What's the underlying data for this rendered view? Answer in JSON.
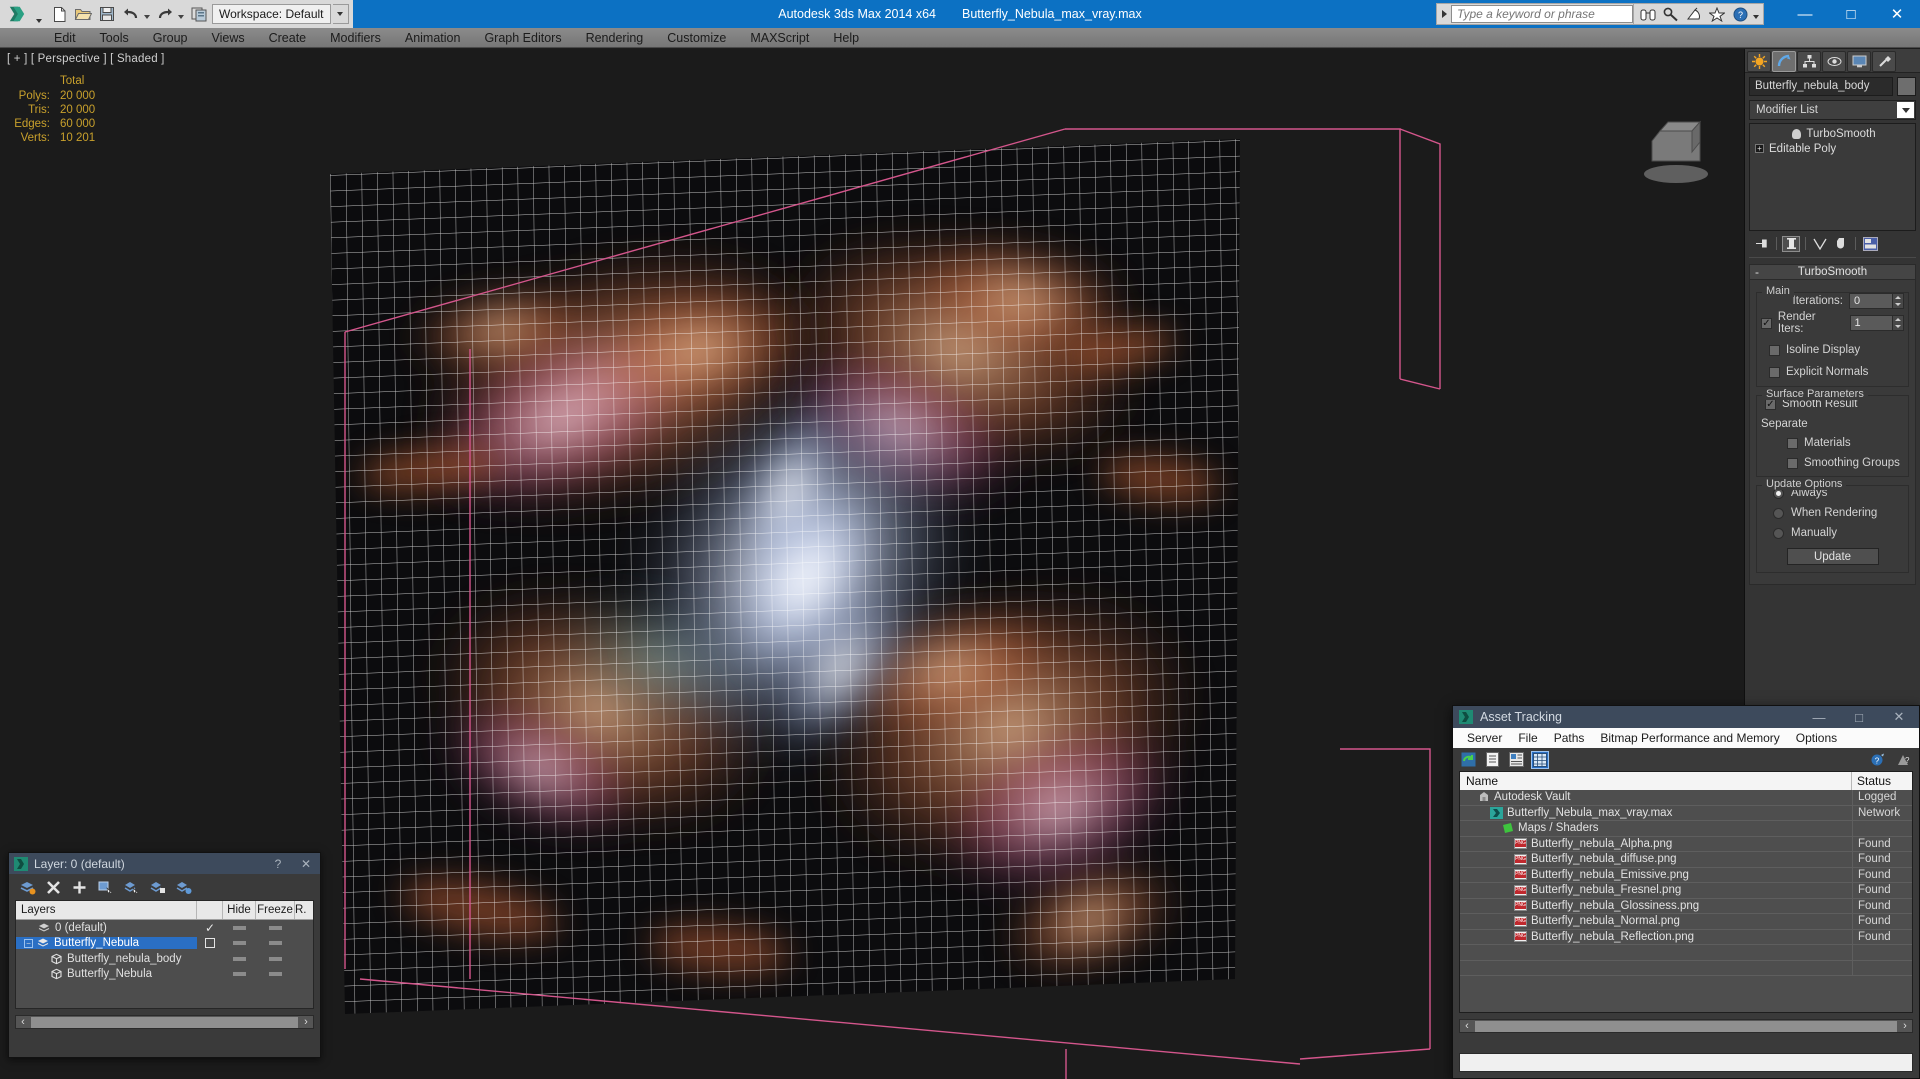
{
  "titlebar": {
    "app_title": "Autodesk 3ds Max  2014 x64",
    "file_name": "Butterfly_Nebula_max_vray.max",
    "workspace_label": "Workspace: Default",
    "search_placeholder": "Type a keyword or phrase",
    "minimize": "—",
    "maximize": "□",
    "close": "✕"
  },
  "menubar": {
    "items": [
      {
        "label": "Edit"
      },
      {
        "label": "Tools"
      },
      {
        "label": "Group"
      },
      {
        "label": "Views"
      },
      {
        "label": "Create"
      },
      {
        "label": "Modifiers"
      },
      {
        "label": "Animation"
      },
      {
        "label": "Graph Editors"
      },
      {
        "label": "Rendering"
      },
      {
        "label": "Customize"
      },
      {
        "label": "MAXScript"
      },
      {
        "label": "Help"
      }
    ]
  },
  "viewport": {
    "label": "[ + ] [ Perspective ] [ Shaded ]",
    "stats": {
      "header": "Total",
      "rows": [
        {
          "label": "Polys:",
          "value": "20 000"
        },
        {
          "label": "Tris:",
          "value": "20 000"
        },
        {
          "label": "Edges:",
          "value": "60 000"
        },
        {
          "label": "Verts:",
          "value": "10 201"
        }
      ]
    }
  },
  "command_panel": {
    "object_name": "Butterfly_nebula_body",
    "modifier_list_label": "Modifier List",
    "stack": [
      {
        "label": "TurboSmooth"
      },
      {
        "label": "Editable Poly"
      }
    ],
    "turbosmooth": {
      "title": "TurboSmooth",
      "minus": "-",
      "main_group": "Main",
      "iterations_label": "Iterations:",
      "iterations_value": "0",
      "render_iters_label": "Render Iters:",
      "render_iters_value": "1",
      "render_iters_checked": true,
      "isoline_display": "Isoline Display",
      "isoline_checked": false,
      "explicit_normals": "Explicit Normals",
      "explicit_checked": false,
      "surface_group": "Surface Parameters",
      "smooth_result": "Smooth Result",
      "smooth_checked": true,
      "separate_label": "Separate",
      "materials": "Materials",
      "materials_checked": false,
      "smoothing_groups": "Smoothing Groups",
      "smoothing_groups_checked": false,
      "update_group": "Update Options",
      "always": "Always",
      "when_rendering": "When Rendering",
      "manually": "Manually",
      "selected_update": "always",
      "update_button": "Update"
    }
  },
  "layer_dialog": {
    "title": "Layer: 0 (default)",
    "help": "?",
    "close": "✕",
    "columns": {
      "layers": "Layers",
      "hide": "Hide",
      "freeze": "Freeze",
      "render": "R."
    },
    "rows": [
      {
        "name": "0 (default)",
        "indent": 0,
        "selected": false,
        "check": "✓",
        "type": "layer"
      },
      {
        "name": "Butterfly_Nebula",
        "indent": 1,
        "selected": true,
        "check": "box",
        "type": "layer"
      },
      {
        "name": "Butterfly_nebula_body",
        "indent": 2,
        "selected": false,
        "check": "",
        "type": "object"
      },
      {
        "name": "Butterfly_Nebula",
        "indent": 2,
        "selected": false,
        "check": "",
        "type": "object"
      }
    ]
  },
  "asset_tracking": {
    "title": "Asset Tracking",
    "minimize": "—",
    "maximize": "□",
    "close": "✕",
    "menu": [
      "Server",
      "File",
      "Paths",
      "Bitmap Performance and Memory",
      "Options"
    ],
    "columns": {
      "name": "Name",
      "status": "Status"
    },
    "rows": [
      {
        "name": "Autodesk Vault",
        "status": "Logged",
        "indent": 1,
        "icon": "vault"
      },
      {
        "name": "Butterfly_Nebula_max_vray.max",
        "status": "Network",
        "indent": 2,
        "icon": "max"
      },
      {
        "name": "Maps / Shaders",
        "status": "",
        "indent": 3,
        "icon": "maps"
      },
      {
        "name": "Butterfly_nebula_Alpha.png",
        "status": "Found",
        "indent": 4,
        "icon": "png"
      },
      {
        "name": "Butterfly_nebula_diffuse.png",
        "status": "Found",
        "indent": 4,
        "icon": "png"
      },
      {
        "name": "Butterfly_nebula_Emissive.png",
        "status": "Found",
        "indent": 4,
        "icon": "png"
      },
      {
        "name": "Butterfly_nebula_Fresnel.png",
        "status": "Found",
        "indent": 4,
        "icon": "png"
      },
      {
        "name": "Butterfly_nebula_Glossiness.png",
        "status": "Found",
        "indent": 4,
        "icon": "png"
      },
      {
        "name": "Butterfly_nebula_Normal.png",
        "status": "Found",
        "indent": 4,
        "icon": "png"
      },
      {
        "name": "Butterfly_nebula_Reflection.png",
        "status": "Found",
        "indent": 4,
        "icon": "png"
      }
    ],
    "scroll_left": "‹",
    "scroll_right": "›"
  },
  "colors": {
    "title_blue": "#0c71c3",
    "stats_gold": "#c8a02c",
    "selection_pink": "#d4568c",
    "dialog_header": "#3d4a5c",
    "highlight_blue": "#2a6fc4"
  }
}
